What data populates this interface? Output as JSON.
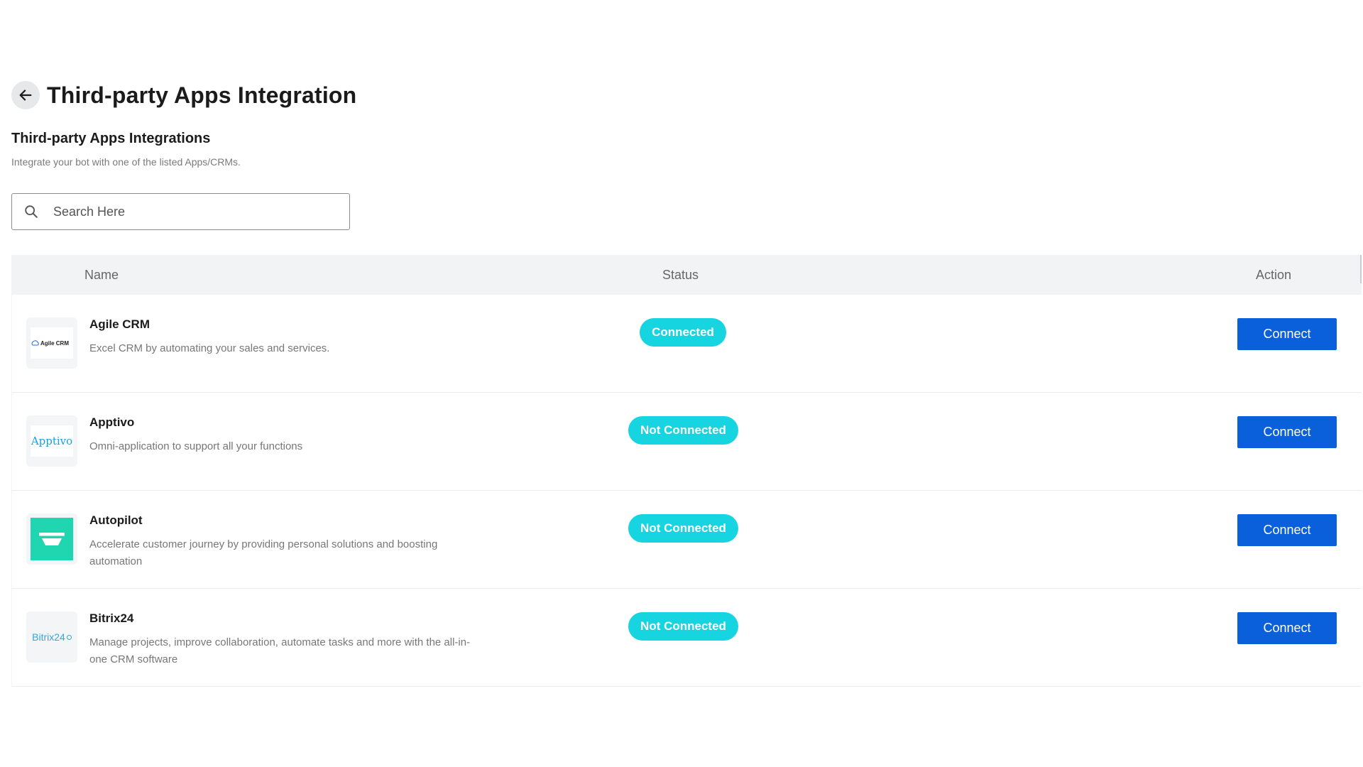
{
  "header": {
    "title": "Third-party Apps Integration",
    "back_icon": "arrow-left-icon"
  },
  "section": {
    "title": "Third-party Apps Integrations",
    "subtitle": "Integrate your bot with one of the listed Apps/CRMs."
  },
  "search": {
    "placeholder": "Search Here",
    "value": "",
    "icon": "search-icon"
  },
  "table": {
    "columns": [
      "Name",
      "Status",
      "Action"
    ],
    "rows": [
      {
        "logo_text": "Agile CRM",
        "name": "Agile CRM",
        "description": "Excel CRM by automating your sales and services.",
        "status": "Connected",
        "action": "Connect"
      },
      {
        "logo_text": "Apptivo",
        "name": "Apptivo",
        "description": "Omni-application to support all your functions",
        "status": "Not Connected",
        "action": "Connect"
      },
      {
        "logo_text": "",
        "name": "Autopilot",
        "description": "Accelerate customer journey by providing personal solutions and boosting automation",
        "status": "Not Connected",
        "action": "Connect"
      },
      {
        "logo_text": "Bitrix24",
        "name": "Bitrix24",
        "description": "Manage projects, improve collaboration, automate tasks and more with the all-in-one CRM software",
        "status": "Not Connected",
        "action": "Connect"
      }
    ]
  },
  "colors": {
    "badge": "#17d5e0",
    "button": "#0a5fdb",
    "autopilot": "#1fd6b0",
    "apptivo": "#1aa0d8",
    "bitrix": "#2fa7e0"
  }
}
